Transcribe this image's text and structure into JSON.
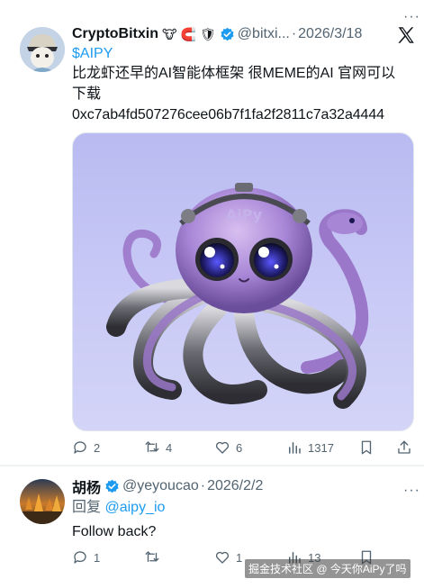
{
  "tweet1": {
    "display_name": "CryptoBitxin",
    "name_emojis": [
      "🐮",
      "🧲",
      "🛡"
    ],
    "handle": "@bitxi...",
    "separator": "·",
    "date": "2026/3/18",
    "more_label": "···",
    "cashtag": "$AIPY",
    "line1": "比龙虾还早的AI智能体框架 很MEME的AI 官网可以",
    "line2": "下载",
    "contract": "0xc7ab4fd507276cee06b7f1fa2f2811c7a32a4444",
    "image_label": "AiPy",
    "stats": {
      "replies": "2",
      "reposts": "4",
      "likes": "6",
      "views": "1317"
    }
  },
  "tweet2": {
    "display_name": "胡杨",
    "handle": "@yeyoucao",
    "separator": "·",
    "date": "2026/2/2",
    "more_label": "···",
    "reply_prefix": "回复",
    "reply_to": "@aipy_io",
    "text": "Follow back?",
    "stats": {
      "replies": "1",
      "reposts": "",
      "likes": "1",
      "views": "13"
    }
  },
  "watermark": "掘金技术社区 @ 今天你AiPy了吗",
  "colors": {
    "link": "#1d9bf0",
    "muted": "#536471",
    "text": "#0f1419",
    "octopus": "#9a77c9"
  }
}
